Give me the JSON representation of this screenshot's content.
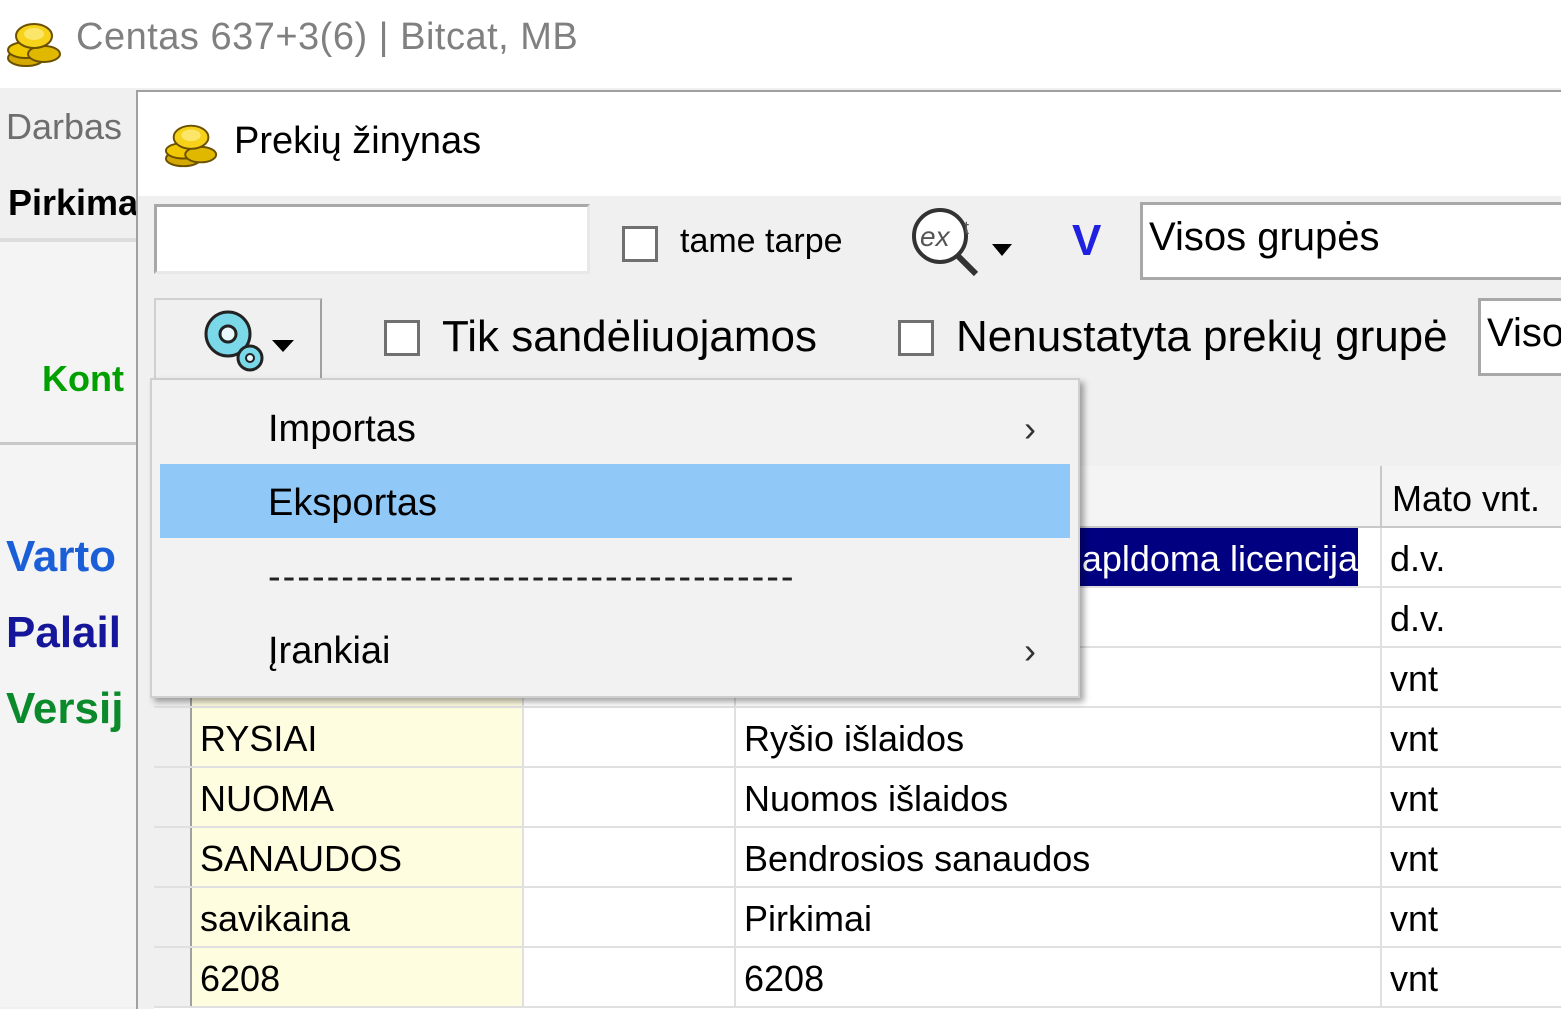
{
  "app": {
    "title": "Centas 637+3(6) | Bitcat, MB",
    "menu_darbas": "Darbas",
    "tab_pirkimai": "Pirkima",
    "left_links": {
      "kont": "Kont",
      "varto": "Varto",
      "palai": "Palail",
      "versij": "Versij"
    }
  },
  "window": {
    "title": "Prekių žinynas"
  },
  "toolbar": {
    "search_value": "",
    "tame_tarpe_label": "tame tarpe",
    "tame_tarpe_checked": false,
    "ext_icon": "ext-search-icon",
    "v_label": "V",
    "groups_select": "Visos grupės",
    "tik_sandeliuojamos_label": "Tik sandėliuojamos",
    "tik_sandeliuojamos_checked": false,
    "nenustatyta_label": "Nenustatyta prekių grupė",
    "nenustatyta_checked": false,
    "second_select": "Visos"
  },
  "grid": {
    "headers": [
      "",
      "",
      "",
      "Mato vnt."
    ],
    "rows": [
      {
        "code": "",
        "col2": "",
        "name": "apldoma licencija",
        "unit": "d.v.",
        "selected": true
      },
      {
        "code": "",
        "col2": "",
        "name": "",
        "unit": "d.v."
      },
      {
        "code": "",
        "col2": "",
        "name": "",
        "unit": "vnt"
      },
      {
        "code": "RYSIAI",
        "col2": "",
        "name": "Ryšio išlaidos",
        "unit": "vnt"
      },
      {
        "code": "NUOMA",
        "col2": "",
        "name": "Nuomos išlaidos",
        "unit": "vnt"
      },
      {
        "code": "SANAUDOS",
        "col2": "",
        "name": "Bendrosios sanaudos",
        "unit": "vnt"
      },
      {
        "code": "savikaina",
        "col2": "",
        "name": "Pirkimai",
        "unit": "vnt"
      },
      {
        "code": "6208",
        "col2": "",
        "name": "6208",
        "unit": "vnt"
      }
    ]
  },
  "popup_menu": {
    "items": [
      {
        "label": "Importas",
        "submenu": true,
        "highlighted": false
      },
      {
        "label": "Eksportas",
        "submenu": false,
        "highlighted": true
      },
      {
        "label": "------------------------------------",
        "separator": true
      },
      {
        "label": "Įrankiai",
        "submenu": true,
        "highlighted": false
      }
    ]
  },
  "colors": {
    "highlight": "#90c8f8",
    "selection": "#000080",
    "code_column": "#fffde0"
  }
}
